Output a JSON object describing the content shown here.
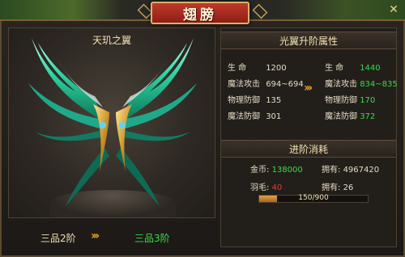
{
  "window": {
    "title": "翅膀",
    "close_symbol": "✕"
  },
  "left": {
    "wing_name": "天玑之翼",
    "current_tier": "三品2阶",
    "next_tier": "三品3阶",
    "arrow": "›››"
  },
  "attributes": {
    "heading": "光翼升阶属性",
    "current": [
      {
        "label": "生    命",
        "value": "1200"
      },
      {
        "label": "魔法攻击",
        "value": "694~694"
      },
      {
        "label": "物理防御",
        "value": "135"
      },
      {
        "label": "魔法防御",
        "value": "301"
      }
    ],
    "next": [
      {
        "label": "生    命",
        "value": "1440"
      },
      {
        "label": "魔法攻击",
        "value": "834~835"
      },
      {
        "label": "物理防御",
        "value": "170"
      },
      {
        "label": "魔法防御",
        "value": "372"
      }
    ],
    "arrow": "›››"
  },
  "cost": {
    "heading": "进阶消耗",
    "gold_label": "金币:",
    "gold_value": "138000",
    "gold_owned_label": "拥有:",
    "gold_owned_value": "4967420",
    "feather_label": "羽毛:",
    "feather_value": "40",
    "feather_owned_label": "拥有:",
    "feather_owned_value": "26",
    "progress_text": "150/900",
    "progress_fraction": 0.1667
  },
  "colors": {
    "accent_green": "#3cd94a",
    "accent_red": "#e33b2e",
    "gold": "#e89a2c"
  }
}
